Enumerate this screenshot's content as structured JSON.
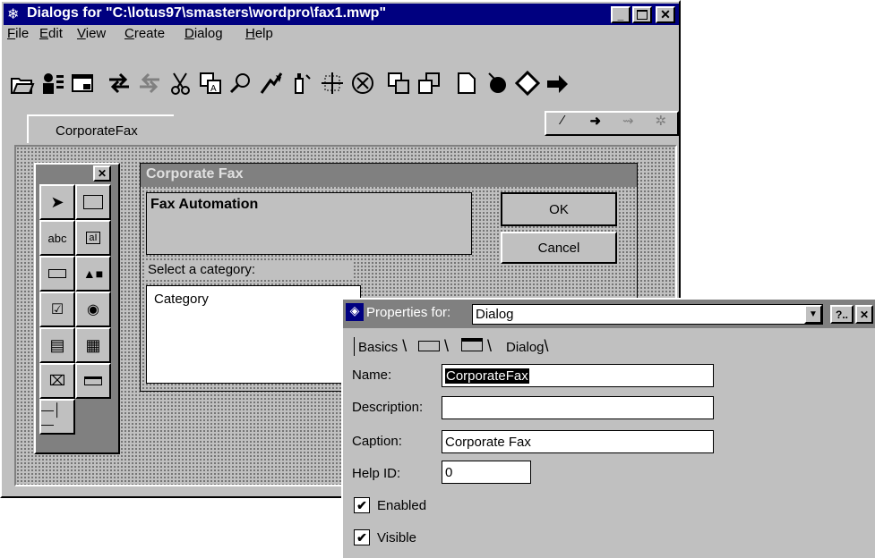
{
  "main_window": {
    "title": "Dialogs for \"C:\\lotus97\\smasters\\wordpro\\fax1.mwp\"",
    "menu": [
      "File",
      "Edit",
      "View",
      "Create",
      "Dialog",
      "Help"
    ],
    "menu_underline": [
      "F",
      "E",
      "V",
      "C",
      "D",
      "H"
    ],
    "tab_label": "CorporateFax"
  },
  "toolbar_icons": [
    "open-icon",
    "user-props-icon",
    "dialog-props-icon",
    "undo-icon",
    "redo-icon",
    "cut-icon",
    "copy-icon",
    "find-icon",
    "auto-icon",
    "glue-icon",
    "grid-icon",
    "delete-icon",
    "send-back-icon",
    "bring-front-icon",
    "new-dialog-icon",
    "run-icon",
    "shape-icon",
    "exit-icon"
  ],
  "palette_icons": [
    "arrow-pointer-icon",
    "frame-icon",
    "label-icon",
    "edit-field-icon",
    "push-button-icon",
    "picture-icon",
    "checkbox-icon",
    "radio-button-icon",
    "list-box-icon",
    "combo-box-icon",
    "scroll-icon",
    "ruler-icon",
    "slider-icon"
  ],
  "palette": {
    "label_tool": "abc",
    "edit_tool": "aI"
  },
  "dialog_preview": {
    "caption": "Corporate Fax",
    "heading": "Fax Automation",
    "ok": "OK",
    "cancel": "Cancel",
    "select_label": "Select a category:",
    "list_item": "Category"
  },
  "properties": {
    "title": "Properties for:",
    "object": "Dialog",
    "help_btn": "?..",
    "tabs": [
      "Basics",
      "Dialog"
    ],
    "name_label": "Name:",
    "name_value": "CorporateFax",
    "desc_label": "Description:",
    "desc_value": "",
    "caption_label": "Caption:",
    "caption_value": "Corporate Fax",
    "helpid_label": "Help ID:",
    "helpid_value": "0",
    "enabled_label": "Enabled",
    "enabled_checked": true,
    "visible_label": "Visible",
    "visible_checked": true
  },
  "colors": {
    "titlebar": "#000080",
    "face": "#c0c0c0",
    "dialog_caption": "#808080"
  }
}
